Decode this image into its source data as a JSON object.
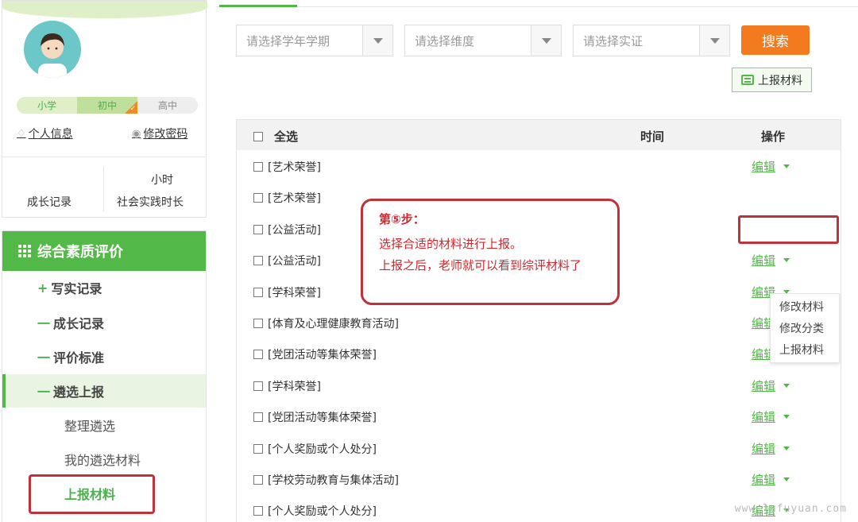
{
  "profile": {
    "levels": [
      "小学",
      "初中",
      "高中"
    ],
    "personal_info": "个人信息",
    "change_password": "修改密码",
    "stat_unit": "小时",
    "growth_record": "成长记录",
    "social_practice": "社会实践时长"
  },
  "menu": {
    "title": "综合素质评价",
    "items": [
      {
        "prefix": "+",
        "label": "写实记录"
      },
      {
        "prefix": "一",
        "label": "成长记录"
      },
      {
        "prefix": "一",
        "label": "评价标准"
      },
      {
        "prefix": "一",
        "label": "遴选上报"
      }
    ],
    "sub_items": [
      "整理遴选",
      "我的遴选材料",
      "上报材料"
    ]
  },
  "filters": {
    "term_placeholder": "请选择学年学期",
    "dimension_placeholder": "请选择维度",
    "evidence_placeholder": "请选择实证",
    "search_label": "搜索",
    "upload_label": "上报材料"
  },
  "table": {
    "col_select_all": "全选",
    "col_time": "时间",
    "col_action": "操作",
    "edit_label": "编辑",
    "rows": [
      "[艺术荣誉]",
      "[艺术荣誉]",
      "[公益活动]",
      "[公益活动]",
      "[学科荣誉]",
      "[体育及心理健康教育活动]",
      "[党团活动等集体荣誉]",
      "[学科荣誉]",
      "[党团活动等集体荣誉]",
      "[个人奖励或个人处分]",
      "[学校劳动教育与集体活动]",
      "[个人奖励或个人处分]"
    ],
    "dropdown": [
      "修改材料",
      "修改分类",
      "上报材料"
    ]
  },
  "callout": {
    "title": "第⑤步：",
    "line1": "选择合适的材料进行上报。",
    "line2": "上报之后，老师就可以看到综评材料了"
  },
  "watermark": "www.lufuyuan.com",
  "colors": {
    "brand_green": "#52b848",
    "accent_orange": "#f47a1f",
    "annotation_red": "#c0313a"
  }
}
